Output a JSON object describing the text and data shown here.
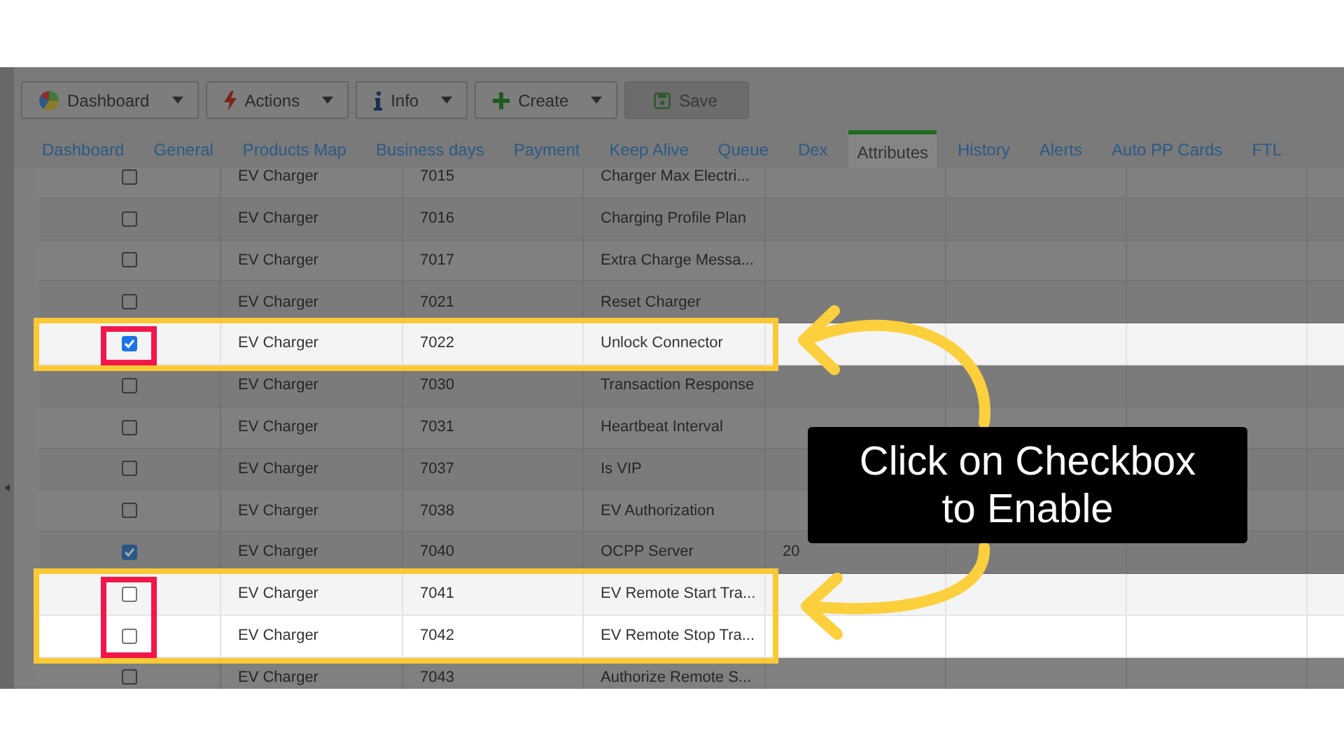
{
  "toolbar": [
    {
      "kind": "pie",
      "label": "Dashboard",
      "dropdown": true,
      "disabled": false
    },
    {
      "kind": "bolt",
      "label": "Actions",
      "dropdown": true,
      "disabled": false
    },
    {
      "kind": "info",
      "label": "Info",
      "dropdown": true,
      "disabled": false
    },
    {
      "kind": "plus",
      "label": "Create",
      "dropdown": true,
      "disabled": false
    },
    {
      "kind": "save",
      "label": "Save",
      "dropdown": false,
      "disabled": true
    }
  ],
  "tabs": [
    {
      "label": "Dashboard",
      "selected": false
    },
    {
      "label": "General",
      "selected": false
    },
    {
      "label": "Products Map",
      "selected": false
    },
    {
      "label": "Business days",
      "selected": false
    },
    {
      "label": "Payment",
      "selected": false
    },
    {
      "label": "Keep Alive",
      "selected": false
    },
    {
      "label": "Queue",
      "selected": false
    },
    {
      "label": "Dex",
      "selected": false
    },
    {
      "label": "Attributes",
      "selected": true
    },
    {
      "label": "History",
      "selected": false
    },
    {
      "label": "Alerts",
      "selected": false
    },
    {
      "label": "Auto PP Cards",
      "selected": false
    },
    {
      "label": "FTL",
      "selected": false
    }
  ],
  "table": {
    "rows": [
      {
        "checked": false,
        "highlighted": false,
        "cells": [
          "EV Charger",
          "7015",
          "Charger Max Electri..."
        ]
      },
      {
        "checked": false,
        "highlighted": false,
        "cells": [
          "EV Charger",
          "7016",
          "Charging Profile Plan"
        ]
      },
      {
        "checked": false,
        "highlighted": false,
        "cells": [
          "EV Charger",
          "7017",
          "Extra Charge Messa..."
        ]
      },
      {
        "checked": false,
        "highlighted": false,
        "cells": [
          "EV Charger",
          "7021",
          "Reset Charger"
        ]
      },
      {
        "checked": true,
        "highlighted": true,
        "cells": [
          "EV Charger",
          "7022",
          "Unlock Connector"
        ]
      },
      {
        "checked": false,
        "highlighted": false,
        "cells": [
          "EV Charger",
          "7030",
          "Transaction Response"
        ]
      },
      {
        "checked": false,
        "highlighted": false,
        "cells": [
          "EV Charger",
          "7031",
          "Heartbeat Interval"
        ]
      },
      {
        "checked": false,
        "highlighted": false,
        "cells": [
          "EV Charger",
          "7037",
          "Is VIP"
        ]
      },
      {
        "checked": false,
        "highlighted": false,
        "cells": [
          "EV Charger",
          "7038",
          "EV Authorization"
        ]
      },
      {
        "checked": true,
        "highlighted": false,
        "cells": [
          "EV Charger",
          "7040",
          "OCPP Server",
          "20"
        ]
      },
      {
        "checked": false,
        "highlighted": true,
        "cells": [
          "EV Charger",
          "7041",
          "EV Remote Start Tra..."
        ]
      },
      {
        "checked": false,
        "highlighted": true,
        "cells": [
          "EV Charger",
          "7042",
          "EV Remote Stop Tra..."
        ]
      },
      {
        "checked": false,
        "highlighted": false,
        "cells": [
          "EV Charger",
          "7043",
          "Authorize Remote S..."
        ]
      }
    ]
  },
  "callout": {
    "lines": [
      "Click on Checkbox",
      "to Enable"
    ]
  }
}
